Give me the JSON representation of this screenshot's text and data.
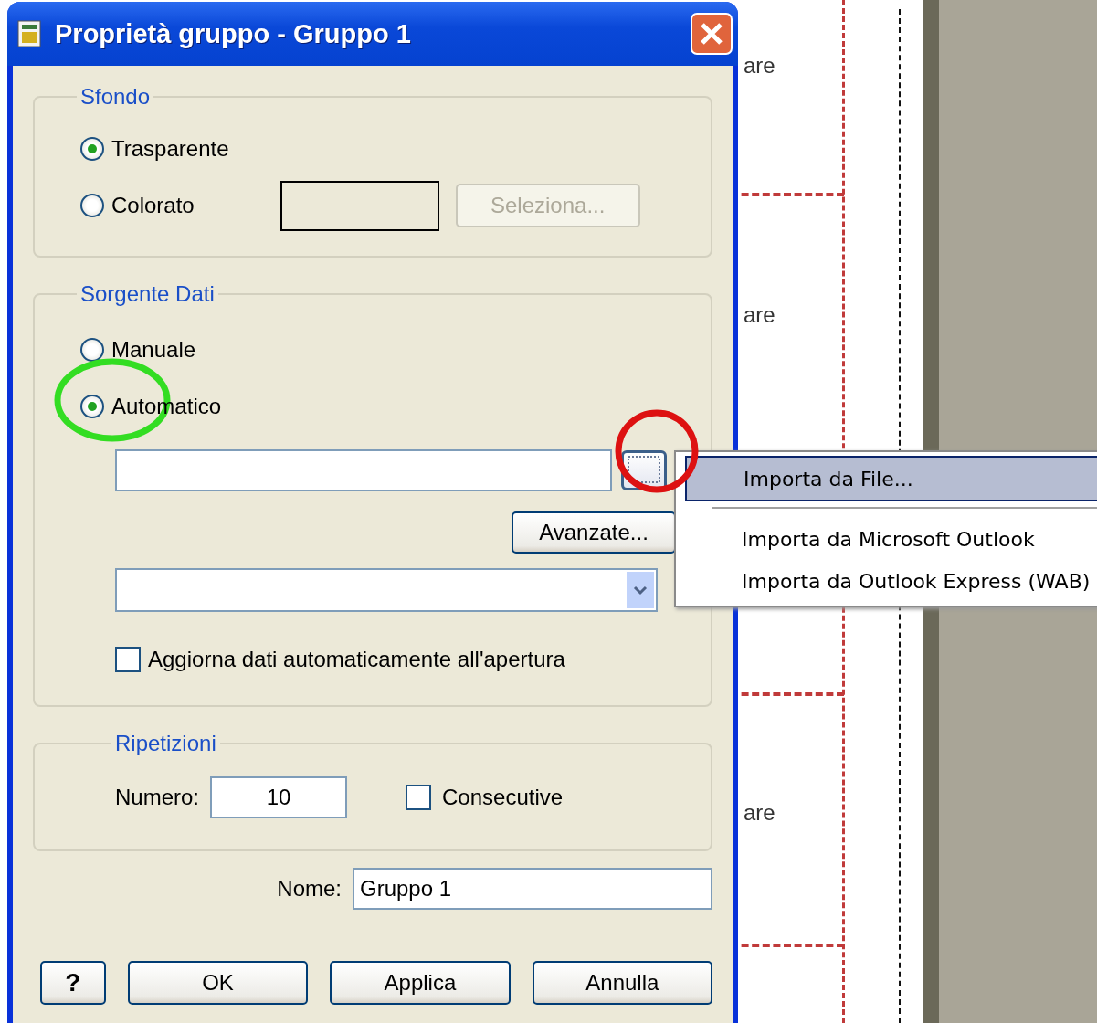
{
  "window": {
    "title": "Proprietà gruppo - Gruppo 1"
  },
  "sfondo": {
    "title": "Sfondo",
    "options": [
      {
        "label": "Trasparente",
        "selected": true
      },
      {
        "label": "Colorato",
        "selected": false
      }
    ],
    "color_button": {
      "label": "Seleziona...",
      "disabled": true
    }
  },
  "sorgente_dati": {
    "title": "Sorgente Dati",
    "options": [
      {
        "label": "Manuale",
        "selected": false
      },
      {
        "label": "Automatico",
        "selected": true
      }
    ],
    "advanced_button": "Avanzate...",
    "auto_update": {
      "label": "Aggiorna dati automaticamente all'apertura",
      "checked": false
    }
  },
  "ripetizioni": {
    "title": "Ripetizioni",
    "number_label": "Numero:",
    "number_value": "10",
    "consecutive": {
      "label": "Consecutive",
      "checked": false
    }
  },
  "name": {
    "label": "Nome:",
    "value": "Gruppo 1"
  },
  "buttons": [
    {
      "kind": "help",
      "label": "?"
    },
    {
      "kind": "normal",
      "label": "OK"
    },
    {
      "kind": "normal",
      "label": "Applica"
    },
    {
      "kind": "normal",
      "label": "Annulla"
    }
  ],
  "menu": {
    "items": [
      {
        "label": "Importa da File...",
        "selected": true,
        "separator_after": true
      },
      {
        "label": "Importa da Microsoft Outlook",
        "selected": false,
        "separator_after": false
      },
      {
        "label": "Importa da Outlook Express (WAB)",
        "selected": false,
        "separator_after": false
      }
    ]
  },
  "background": {
    "texts": [
      "are",
      "are",
      "are"
    ]
  }
}
